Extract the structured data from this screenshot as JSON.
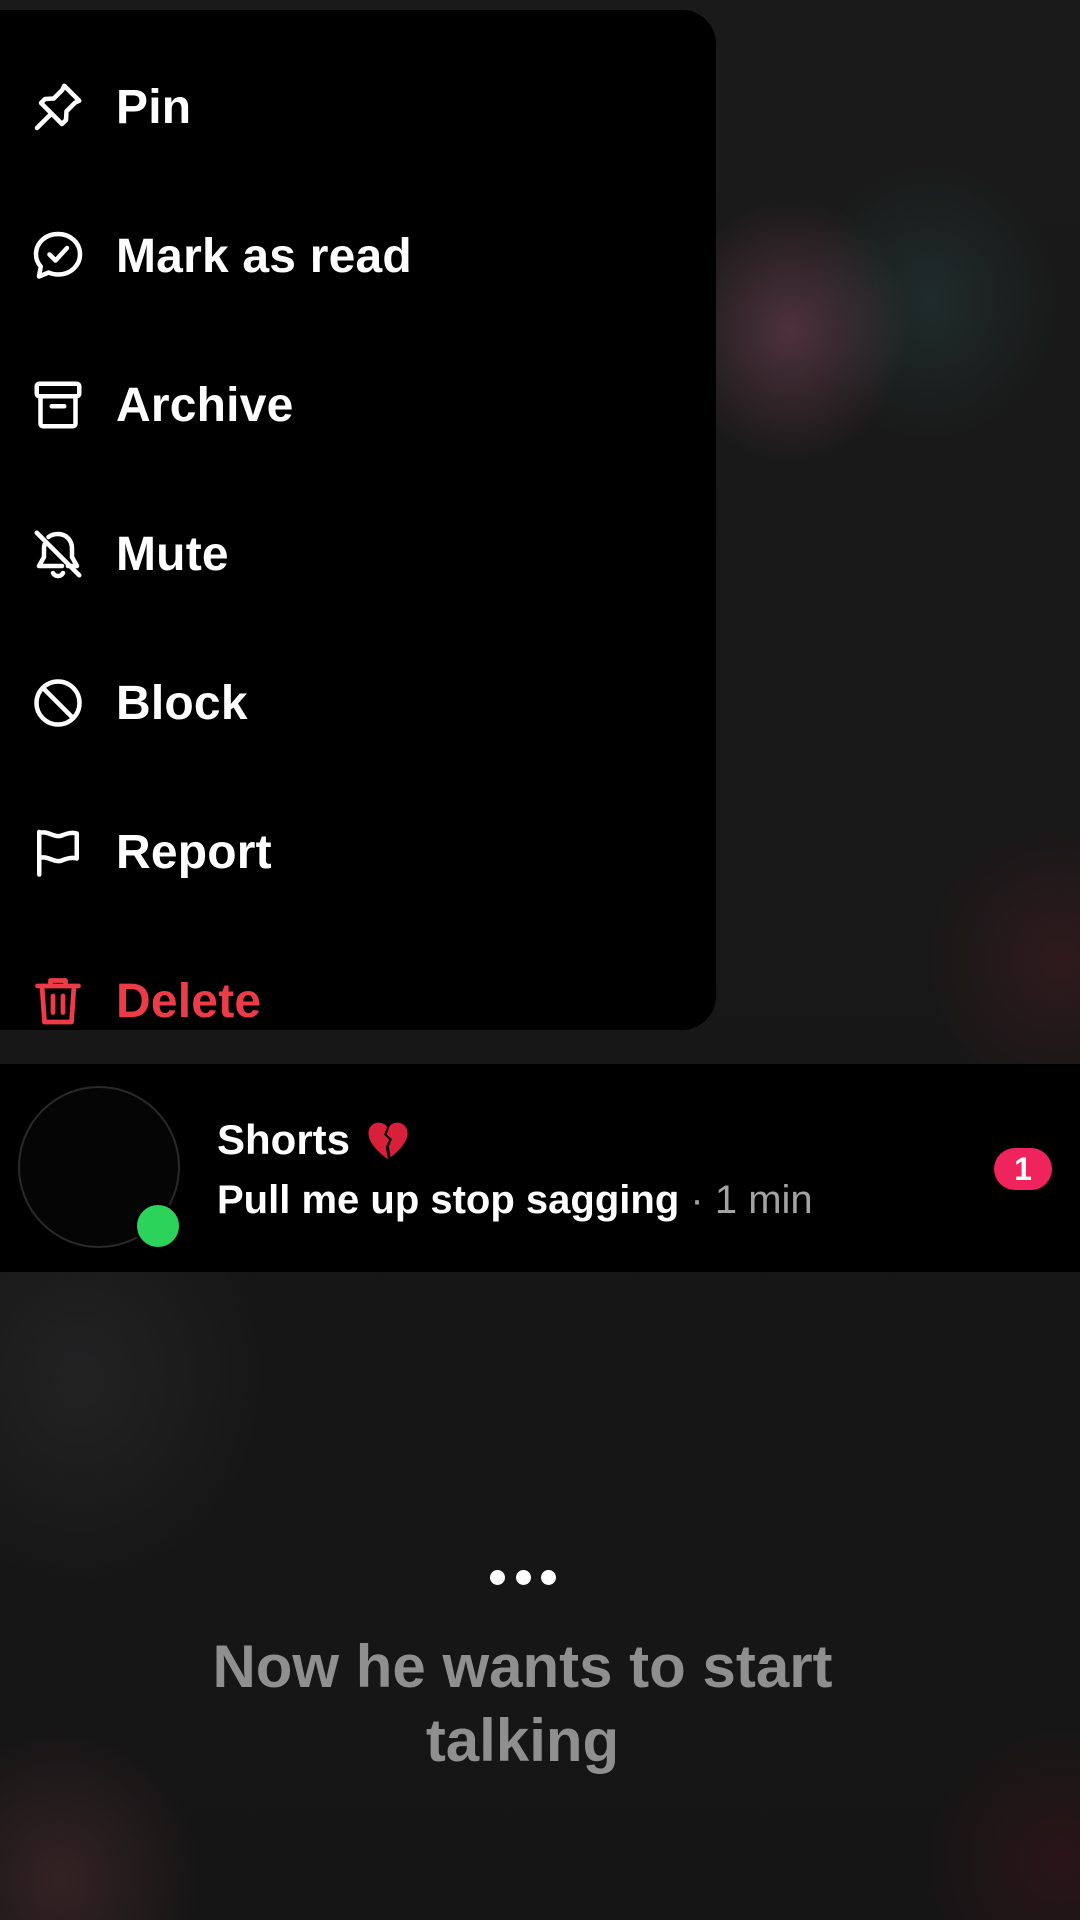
{
  "menu": {
    "items": [
      {
        "label": "Pin",
        "icon": "pin-icon"
      },
      {
        "label": "Mark as read",
        "icon": "mark-read-icon"
      },
      {
        "label": "Archive",
        "icon": "archive-icon"
      },
      {
        "label": "Mute",
        "icon": "mute-bell-icon"
      },
      {
        "label": "Block",
        "icon": "block-icon"
      },
      {
        "label": "Report",
        "icon": "flag-icon"
      },
      {
        "label": "Delete",
        "icon": "trash-icon",
        "color": "#ee3b48"
      }
    ]
  },
  "chat": {
    "name": "Shorts",
    "name_emoji": "broken-heart-icon",
    "preview": "Pull me up stop sagging",
    "separator": "·",
    "time": "1 min",
    "unread_count": "1",
    "online_color": "#2bd35a",
    "badge_color": "#f0245c"
  },
  "caption": {
    "text": "Now he wants to start talking"
  }
}
